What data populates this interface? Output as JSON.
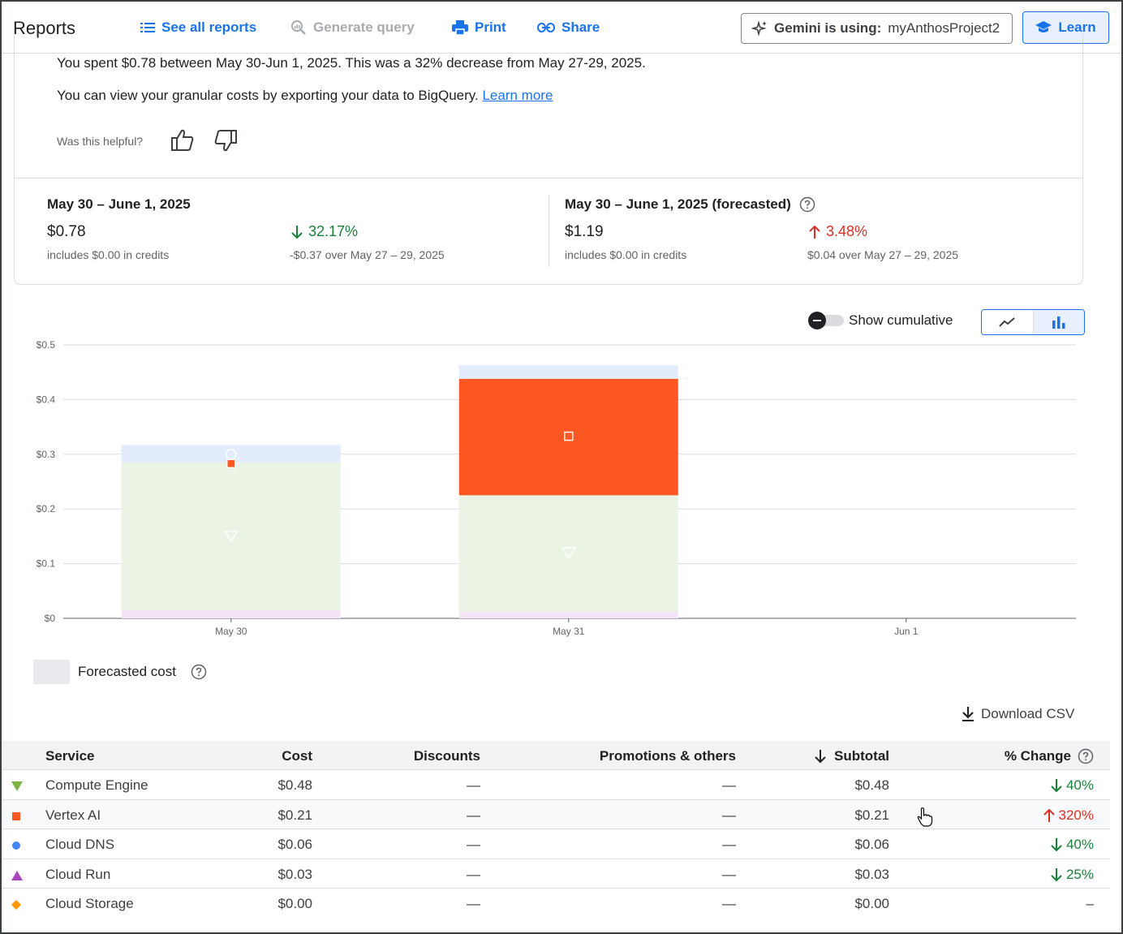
{
  "header": {
    "title": "Reports",
    "see_all": "See all reports",
    "generate_query": "Generate query",
    "print": "Print",
    "share": "Share",
    "gemini_label": "Gemini is using:",
    "gemini_project": "myAnthosProject2",
    "learn": "Learn"
  },
  "summary": {
    "line1": "You spent $0.78 between May 30-Jun 1, 2025. This was a 32% decrease from May 27-29, 2025.",
    "line2_text": "You can view your granular costs by exporting your data to BigQuery.",
    "line2_link": "Learn more",
    "helpful": "Was this helpful?"
  },
  "stats": {
    "actual": {
      "heading": "May 30 – June 1, 2025",
      "value": "$0.78",
      "credits": "includes $0.00 in credits",
      "change": "32.17%",
      "change_sub": "-$0.37 over May 27 – 29, 2025",
      "direction": "down"
    },
    "forecast": {
      "heading": "May 30 – June 1, 2025 (forecasted)",
      "value": "$1.19",
      "credits": "includes $0.00 in credits",
      "change": "3.48%",
      "change_sub": "$0.04 over May 27 – 29, 2025",
      "direction": "up"
    }
  },
  "controls": {
    "show_cumulative": "Show cumulative",
    "cumulative_on": false,
    "chart_mode": "bar"
  },
  "chart_data": {
    "type": "bar",
    "stacked": true,
    "categories": [
      "May 30",
      "May 31",
      "Jun 1"
    ],
    "ylim": [
      0,
      0.5
    ],
    "y_ticks": [
      "$0",
      "$0.1",
      "$0.2",
      "$0.3",
      "$0.4",
      "$0.5"
    ],
    "grid": true,
    "series": [
      {
        "name": "Cloud Run",
        "color": "#f3e5f5",
        "values": [
          0.015,
          0.012,
          0
        ]
      },
      {
        "name": "Compute Engine",
        "color": "#ebf4e4",
        "values": [
          0.27,
          0.213,
          0
        ]
      },
      {
        "name": "Vertex AI",
        "color": "#ff5722",
        "values": [
          0.0,
          0.213,
          0
        ]
      },
      {
        "name": "Cloud DNS",
        "color": "#e3ecfd",
        "values": [
          0.032,
          0.025,
          0
        ]
      }
    ],
    "markers": [
      {
        "category": "May 30",
        "shape": "triangle-down",
        "y": 0.15
      },
      {
        "category": "May 30",
        "shape": "circle",
        "y": 0.3
      },
      {
        "category": "May 30",
        "shape": "square",
        "y": 0.283
      },
      {
        "category": "May 31",
        "shape": "triangle-down",
        "y": 0.12
      },
      {
        "category": "May 31",
        "shape": "square",
        "y": 0.333
      }
    ]
  },
  "legend": {
    "forecasted_cost": "Forecasted cost"
  },
  "download_csv": "Download CSV",
  "table": {
    "columns": {
      "service": "Service",
      "cost": "Cost",
      "discounts": "Discounts",
      "promotions": "Promotions & others",
      "subtotal": "Subtotal",
      "change": "% Change"
    },
    "rows": [
      {
        "marker": "triangle",
        "marker_color": "#7cb342",
        "service": "Compute Engine",
        "cost": "$0.48",
        "discounts": "—",
        "promotions": "—",
        "subtotal": "$0.48",
        "change": "40%",
        "dir": "down"
      },
      {
        "marker": "square",
        "marker_color": "#ff5722",
        "service": "Vertex AI",
        "cost": "$0.21",
        "discounts": "—",
        "promotions": "—",
        "subtotal": "$0.21",
        "change": "320%",
        "dir": "up"
      },
      {
        "marker": "circle",
        "marker_color": "#4285f4",
        "service": "Cloud DNS",
        "cost": "$0.06",
        "discounts": "—",
        "promotions": "—",
        "subtotal": "$0.06",
        "change": "40%",
        "dir": "down"
      },
      {
        "marker": "triangle-up",
        "marker_color": "#ab47bc",
        "service": "Cloud Run",
        "cost": "$0.03",
        "discounts": "—",
        "promotions": "—",
        "subtotal": "$0.03",
        "change": "25%",
        "dir": "down"
      },
      {
        "marker": "diamond",
        "marker_color": "#ff9800",
        "service": "Cloud Storage",
        "cost": "$0.00",
        "discounts": "—",
        "promotions": "—",
        "subtotal": "$0.00",
        "change": "–",
        "dir": "none"
      }
    ]
  }
}
